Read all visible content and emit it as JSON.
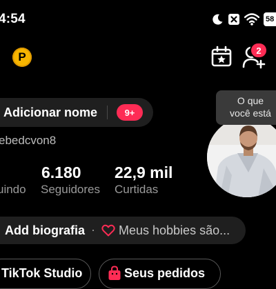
{
  "status_bar": {
    "time": "4:54",
    "icons": [
      "moon-icon",
      "close-notification-icon",
      "wifi-icon"
    ],
    "battery_label": "58"
  },
  "header": {
    "coin_icon_letter": "P",
    "notification_count": "2"
  },
  "profile": {
    "add_name_label": "Adicionar nome",
    "name_badge": "9+",
    "username": "ebedcvon8",
    "tooltip_line1": "O que",
    "tooltip_line2": "você está",
    "stats": [
      {
        "value": "",
        "label": "uindo"
      },
      {
        "value": "6.180",
        "label": "Seguidores"
      },
      {
        "value": "22,9 mil",
        "label": "Curtidas"
      }
    ],
    "add_bio_label": "Add biografia",
    "separator": "·",
    "hobbies_prompt": "Meus hobbies são..."
  },
  "buttons": {
    "studio_label": "TikTok Studio",
    "orders_label": "Seus pedidos"
  },
  "colors": {
    "accent": "#fe2c55",
    "coin": "#f7b500",
    "pill_bg": "#1f1f1f"
  }
}
